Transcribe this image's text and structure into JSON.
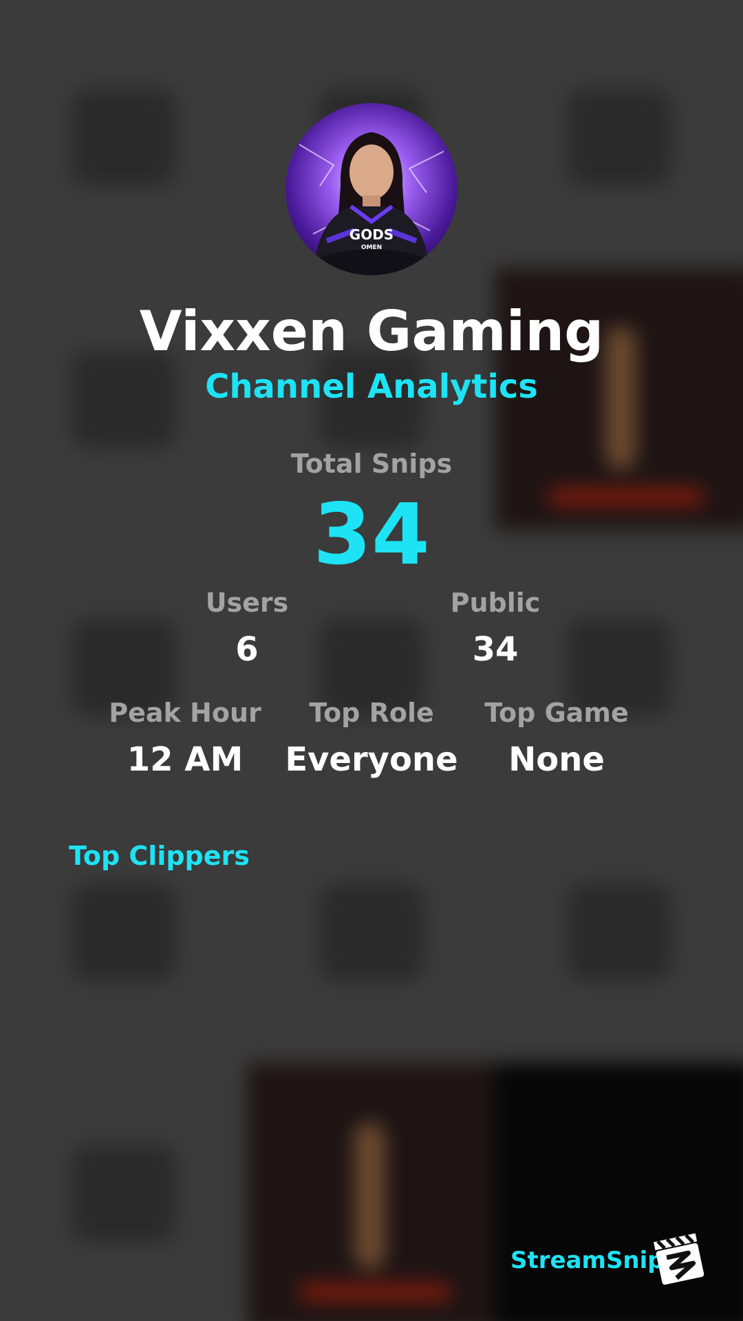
{
  "profile": {
    "channel_name": "Vixxen Gaming",
    "subtitle": "Channel Analytics",
    "avatar_jersey_text": "GODS",
    "avatar_jersey_subtext": "OMEN"
  },
  "stats": {
    "total_snips_label": "Total Snips",
    "total_snips_value": "34",
    "users_label": "Users",
    "users_value": "6",
    "public_label": "Public",
    "public_value": "34",
    "peak_hour_label": "Peak Hour",
    "peak_hour_value": "12 AM",
    "top_role_label": "Top Role",
    "top_role_value": "Everyone",
    "top_game_label": "Top Game",
    "top_game_value": "None"
  },
  "sections": {
    "top_clippers_title": "Top Clippers"
  },
  "branding": {
    "name": "StreamSnip",
    "logo_icon": "clapperboard-icon"
  },
  "colors": {
    "accent": "#1ee3f5",
    "background": "#3b3b3b",
    "label": "#a3a3a3",
    "text": "#ffffff"
  }
}
